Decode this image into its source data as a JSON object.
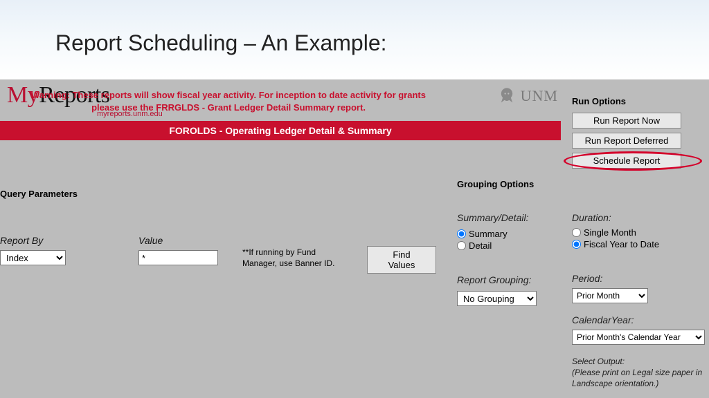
{
  "slide": {
    "title": "Report Scheduling – An Example:"
  },
  "brand": {
    "logo_my": "My",
    "logo_reports": "Reports",
    "subdomain": "myreports.unm.edu",
    "unm": "UNM"
  },
  "report_title": "FOROLDS - Operating Ledger Detail & Summary",
  "warning": "Warning: These reports will show fiscal year activity. For inception to date activity for grants please use the FRRGLDS - Grant Ledger Detail Summary report.",
  "query": {
    "section": "Query Parameters",
    "report_by_label": "Report By",
    "report_by_value": "Index",
    "value_label": "Value",
    "value_value": "*",
    "hint": "**If running by Fund Manager, use Banner ID.",
    "find_values": "Find Values"
  },
  "grouping": {
    "section": "Grouping Options",
    "summary_detail_label": "Summary/Detail:",
    "summary": "Summary",
    "detail": "Detail",
    "report_grouping_label": "Report Grouping:",
    "report_grouping_value": "No Grouping"
  },
  "run": {
    "section": "Run Options",
    "now": "Run Report Now",
    "deferred": "Run Report Deferred",
    "schedule": "Schedule Report"
  },
  "duration": {
    "label": "Duration:",
    "single": "Single Month",
    "fytd": "Fiscal Year to Date"
  },
  "period": {
    "label": "Period:",
    "value": "Prior Month"
  },
  "calendar": {
    "label": "CalendarYear:",
    "value": "Prior Month's Calendar Year"
  },
  "output": {
    "label": "Select Output:",
    "note": "(Please print on Legal size paper in Landscape orientation.)"
  }
}
